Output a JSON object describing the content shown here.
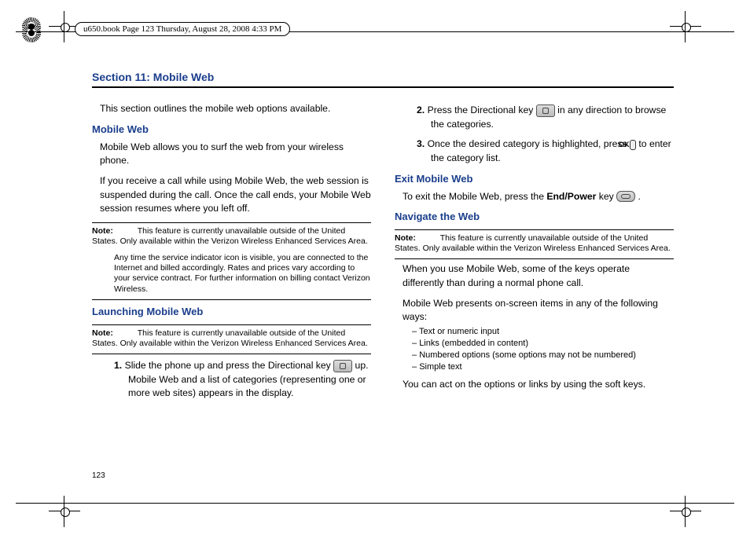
{
  "header": {
    "runhead": "u650.book  Page 123  Thursday, August 28, 2008  4:33 PM"
  },
  "section": {
    "title": "Section 11: Mobile Web"
  },
  "left": {
    "intro": "This section outlines the mobile web options available.",
    "h_mobile_web": "Mobile Web",
    "p_mw1": "Mobile Web allows you to surf the web from your wireless phone.",
    "p_mw2": "If you receive a call while using Mobile Web, the web session is suspended during the call. Once the call ends, your Mobile Web session resumes where you left off.",
    "note1_label": "Note:",
    "note1a": "This feature is currently unavailable outside of the United States. Only available within the Verizon Wireless Enhanced Services Area.",
    "note1b": "Any time the service indicator icon is visible, you are connected to the Internet and billed accordingly. Rates and prices vary according to your service contract. For further information on billing contact Verizon Wireless.",
    "h_launch": "Launching Mobile Web",
    "note2_label": "Note:",
    "note2": "This feature is currently unavailable outside of the United States. Only available within the Verizon Wireless Enhanced Services Area.",
    "step1_num": "1.",
    "step1a": "Slide the phone up and press the Directional key ",
    "step1b": " up. Mobile Web and a list of categories (representing one or more web sites) appears in the display."
  },
  "right": {
    "step2_num": "2.",
    "step2a": "Press the Directional key ",
    "step2b": " in any direction to browse the categories.",
    "step3_num": "3.",
    "step3a": "Once the desired category is highlighted, press ",
    "ok_key": "OK",
    "step3b": " to enter the category list.",
    "h_exit": "Exit Mobile Web",
    "exit_a": "To exit the Mobile Web, press the ",
    "exit_bold": "End/Power",
    "exit_b": " key ",
    "exit_c": " .",
    "h_nav": "Navigate the Web",
    "note3_label": "Note:",
    "note3": "This feature is currently unavailable outside of the United States. Only available within the Verizon Wireless Enhanced Services Area.",
    "p_nav1": "When you use Mobile Web, some of the keys operate differently than during a normal phone call.",
    "p_nav2": "Mobile Web presents on-screen items in any of the following ways:",
    "bullets": [
      "Text or numeric input",
      "Links (embedded in content)",
      "Numbered options (some options may not be numbered)",
      "Simple text"
    ],
    "p_nav3": "You can act on the options or links by using the soft keys."
  },
  "page_number": "123"
}
